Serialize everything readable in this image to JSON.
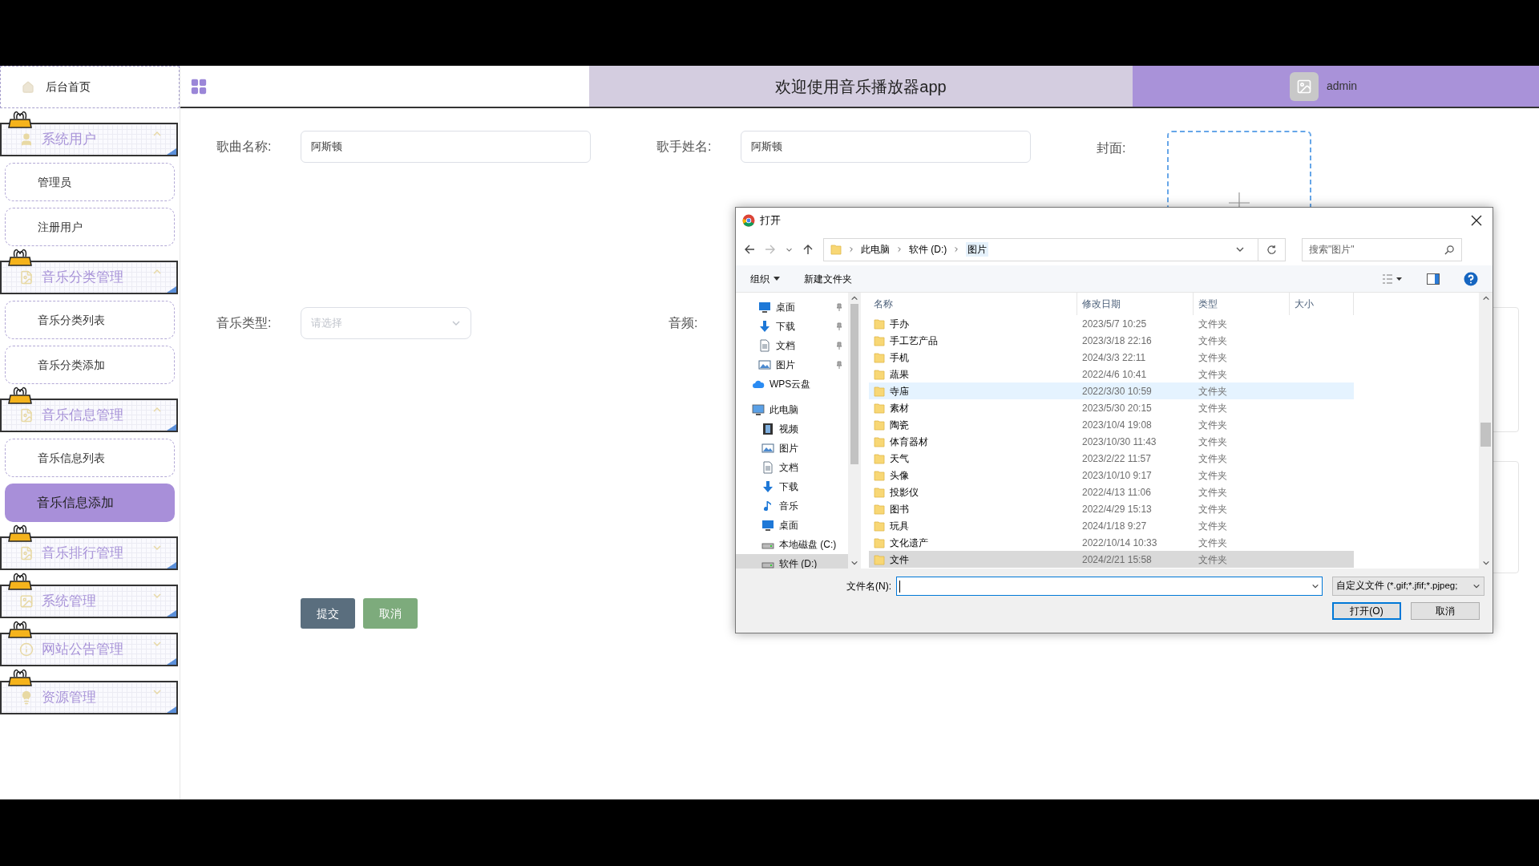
{
  "sidebar": {
    "home": {
      "label": "后台首页"
    },
    "groups": [
      {
        "title": "系统用户",
        "expanded": true,
        "items": [
          {
            "label": "管理员",
            "selected": false
          },
          {
            "label": "注册用户",
            "selected": false
          }
        ]
      },
      {
        "title": "音乐分类管理",
        "expanded": true,
        "items": [
          {
            "label": "音乐分类列表",
            "selected": false
          },
          {
            "label": "音乐分类添加",
            "selected": false
          }
        ]
      },
      {
        "title": "音乐信息管理",
        "expanded": true,
        "items": [
          {
            "label": "音乐信息列表",
            "selected": false
          },
          {
            "label": "音乐信息添加",
            "selected": true
          }
        ]
      },
      {
        "title": "音乐排行管理",
        "expanded": false
      },
      {
        "title": "系统管理",
        "expanded": false
      },
      {
        "title": "网站公告管理",
        "expanded": false
      },
      {
        "title": "资源管理",
        "expanded": false
      }
    ]
  },
  "header": {
    "title": "欢迎使用音乐播放器app",
    "user": "admin"
  },
  "form": {
    "song_name": {
      "label": "歌曲名称:",
      "value": "阿斯顿"
    },
    "singer": {
      "label": "歌手姓名:",
      "value": "阿斯顿"
    },
    "cover": {
      "label": "封面:"
    },
    "music_type": {
      "label": "音乐类型:",
      "placeholder": "请选择"
    },
    "audio": {
      "label": "音频:"
    },
    "buttons": [
      {
        "label": "提交",
        "kind": "primary"
      },
      {
        "label": "取消",
        "kind": "secondary"
      }
    ]
  },
  "dialog": {
    "title": "打开",
    "path": [
      "此电脑",
      "软件 (D:)",
      "图片"
    ],
    "search_placeholder": "搜索\"图片\"",
    "toolbar": {
      "organize": "组织",
      "new_folder": "新建文件夹"
    },
    "nav": [
      {
        "label": "桌面",
        "pinned": true,
        "selected": false
      },
      {
        "label": "下载",
        "pinned": true,
        "selected": false
      },
      {
        "label": "文档",
        "pinned": true,
        "selected": false
      },
      {
        "label": "图片",
        "pinned": true,
        "selected": false
      },
      {
        "label": "WPS云盘",
        "pinned": false,
        "selected": false
      },
      {
        "label": "此电脑",
        "pinned": false,
        "selected": false,
        "children": [
          {
            "label": "视频",
            "pinned": false,
            "selected": false
          },
          {
            "label": "图片",
            "pinned": false,
            "selected": false
          },
          {
            "label": "文档",
            "pinned": false,
            "selected": false
          },
          {
            "label": "下载",
            "pinned": false,
            "selected": false
          },
          {
            "label": "音乐",
            "pinned": false,
            "selected": false
          },
          {
            "label": "桌面",
            "pinned": false,
            "selected": false
          },
          {
            "label": "本地磁盘 (C:)",
            "pinned": false,
            "selected": false
          },
          {
            "label": "软件 (D:)",
            "pinned": false,
            "selected": true
          }
        ]
      }
    ],
    "columns": [
      "名称",
      "修改日期",
      "类型",
      "大小"
    ],
    "rows": [
      {
        "name": "手办",
        "date": "2023/5/7 10:25",
        "type": "文件夹",
        "selected": false,
        "hovered": false
      },
      {
        "name": "手工艺产品",
        "date": "2023/3/18 22:16",
        "type": "文件夹",
        "selected": false,
        "hovered": false
      },
      {
        "name": "手机",
        "date": "2024/3/3 22:11",
        "type": "文件夹",
        "selected": false,
        "hovered": false
      },
      {
        "name": "蔬果",
        "date": "2022/4/6 10:41",
        "type": "文件夹",
        "selected": false,
        "hovered": false
      },
      {
        "name": "寺庙",
        "date": "2022/3/30 10:59",
        "type": "文件夹",
        "selected": false,
        "hovered": true
      },
      {
        "name": "素材",
        "date": "2023/5/30 20:15",
        "type": "文件夹",
        "selected": false,
        "hovered": false
      },
      {
        "name": "陶瓷",
        "date": "2023/10/4 19:08",
        "type": "文件夹",
        "selected": false,
        "hovered": false
      },
      {
        "name": "体育器材",
        "date": "2023/10/30 11:43",
        "type": "文件夹",
        "selected": false,
        "hovered": false
      },
      {
        "name": "天气",
        "date": "2023/2/22 11:57",
        "type": "文件夹",
        "selected": false,
        "hovered": false
      },
      {
        "name": "头像",
        "date": "2023/10/10 9:17",
        "type": "文件夹",
        "selected": false,
        "hovered": false
      },
      {
        "name": "投影仪",
        "date": "2022/4/13 11:06",
        "type": "文件夹",
        "selected": false,
        "hovered": false
      },
      {
        "name": "图书",
        "date": "2022/4/29 15:13",
        "type": "文件夹",
        "selected": false,
        "hovered": false
      },
      {
        "name": "玩具",
        "date": "2024/1/18 9:27",
        "type": "文件夹",
        "selected": false,
        "hovered": false
      },
      {
        "name": "文化遗产",
        "date": "2022/10/14 10:33",
        "type": "文件夹",
        "selected": false,
        "hovered": false
      },
      {
        "name": "文件",
        "date": "2024/2/21 15:58",
        "type": "文件夹",
        "selected": true,
        "hovered": false
      }
    ],
    "filename_label": "文件名(N):",
    "filetype": "自定义文件 (*.gif;*.jfif;*.pjpeg;",
    "buttons": [
      {
        "label": "打开(O)",
        "kind": "default"
      },
      {
        "label": "取消",
        "kind": "normal"
      }
    ]
  }
}
